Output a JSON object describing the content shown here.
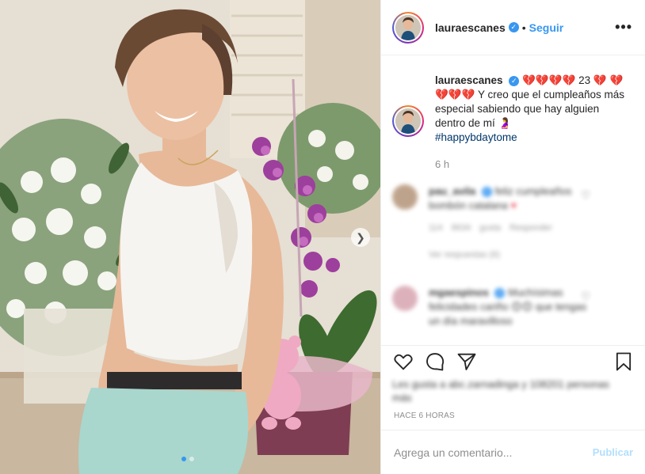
{
  "post": {
    "username": "lauraescanes",
    "verified_icon": "verified-badge-icon",
    "separator": "•",
    "follow_label": "Seguir",
    "more_label": "•••"
  },
  "caption": {
    "username": "lauraescanes",
    "hearts_1": "💔💔💔💔",
    "number": "23",
    "hearts_2": "💔",
    "hearts_3": "💔💔💔💔",
    "text": "Y creo que el cumpleaños más especial sabiendo que hay alguien dentro de mí",
    "emoji": "🤰",
    "hashtag": "#happybdaytome",
    "time": "6 h"
  },
  "comments": [
    {
      "username": "pau_avila",
      "text": "feliz cumpleaños bombón catalana",
      "likes": "114",
      "meta_likes": "8634 gusta",
      "reply_label": "Responder",
      "replies": "Ver respuestas (6)"
    },
    {
      "username": "mgaespinos",
      "text": "Muchísimas felicidades cariño 😊😊 que tengas un día maravilloso",
      "meta": ""
    }
  ],
  "actions": {
    "like_icon": "heart-icon",
    "comment_icon": "comment-icon",
    "share_icon": "share-icon",
    "save_icon": "bookmark-icon"
  },
  "likes_text": "Les gusta a abc.zarnadinga y 108201 personas más",
  "post_time": "HACE 6 HORAS",
  "add_comment": {
    "placeholder": "Agrega un comentario...",
    "publish_label": "Publicar"
  },
  "carousel": {
    "next_icon": "chevron-right-icon",
    "total": 2,
    "current": 1
  },
  "colors": {
    "accent": "#3897f0",
    "heart": "#ed4956",
    "publish_disabled": "#b2dffc",
    "muted": "#8e8e8e"
  }
}
